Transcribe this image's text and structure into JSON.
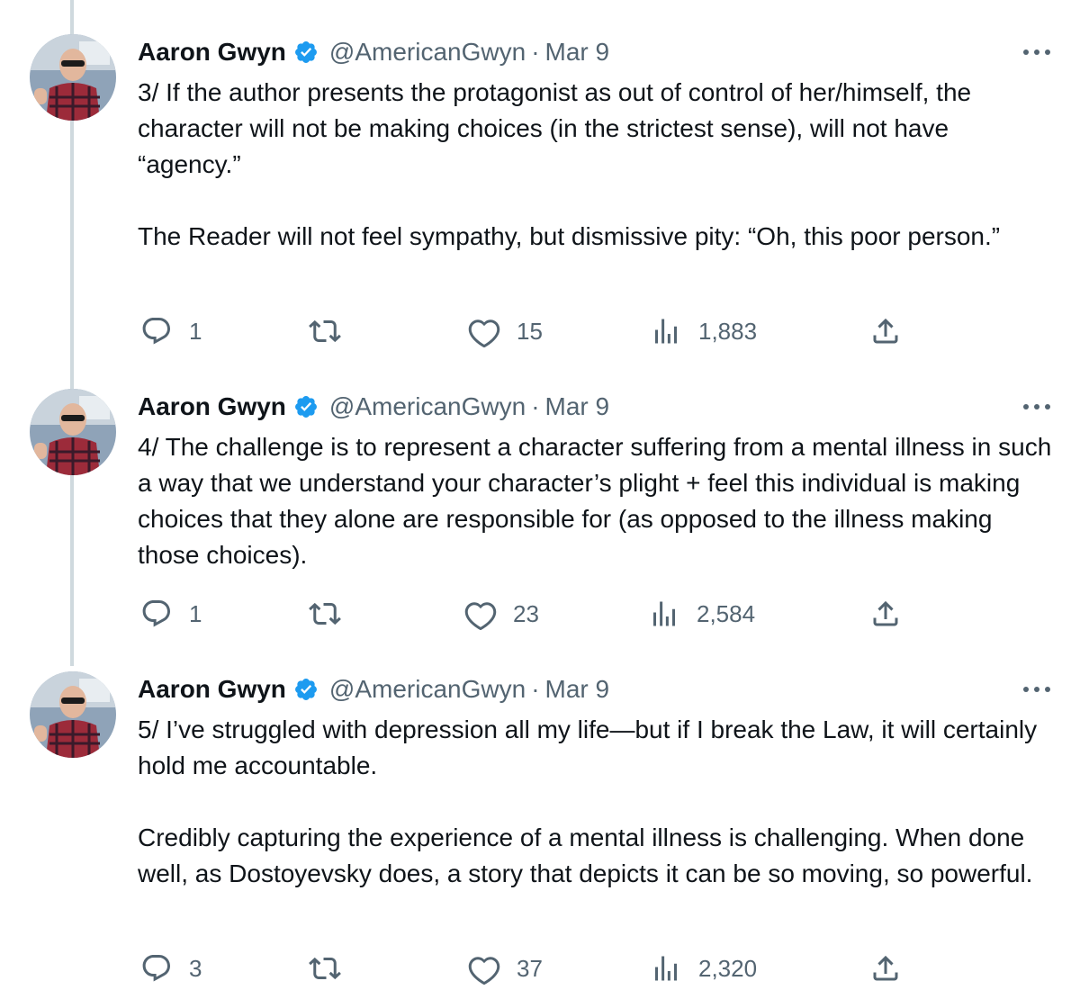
{
  "tweets": [
    {
      "name": "Aaron Gwyn",
      "handle": "@AmericanGwyn",
      "separator": "·",
      "date": "Mar 9",
      "text": "3/ If the author presents the protagonist as out of control of her/himself, the character will not be making choices (in the strictest sense), will not have “agency.”\n\nThe Reader will not feel sympathy, but dismissive pity: “Oh, this poor person.”",
      "replies": "1",
      "retweets": "",
      "likes": "15",
      "views": "1,883"
    },
    {
      "name": "Aaron Gwyn",
      "handle": "@AmericanGwyn",
      "separator": "·",
      "date": "Mar 9",
      "text": "4/ The challenge is to represent a character suffering from a mental illness in such a way that we understand your character’s plight + feel this individual is making choices that they alone are responsible for (as opposed to the illness making those choices).",
      "replies": "1",
      "retweets": "",
      "likes": "23",
      "views": "2,584"
    },
    {
      "name": "Aaron Gwyn",
      "handle": "@AmericanGwyn",
      "separator": "·",
      "date": "Mar 9",
      "text": "5/ I’ve struggled with depression all my life—but if I break the Law, it will certainly hold me accountable.\n\nCredibly capturing the experience of a mental illness is challenging. When done well, as Dostoyevsky does, a story that depicts it can be so moving, so powerful.",
      "replies": "3",
      "retweets": "",
      "likes": "37",
      "views": "2,320"
    }
  ],
  "icons": {
    "verified": "verified-badge-icon",
    "more": "more-options-icon",
    "reply": "reply-icon",
    "retweet": "retweet-icon",
    "like": "heart-icon",
    "views": "views-chart-icon",
    "share": "share-icon"
  },
  "colors": {
    "text": "#0f1419",
    "secondary": "#536471",
    "verified": "#1d9bf0",
    "thread_line": "#cfd9de"
  }
}
